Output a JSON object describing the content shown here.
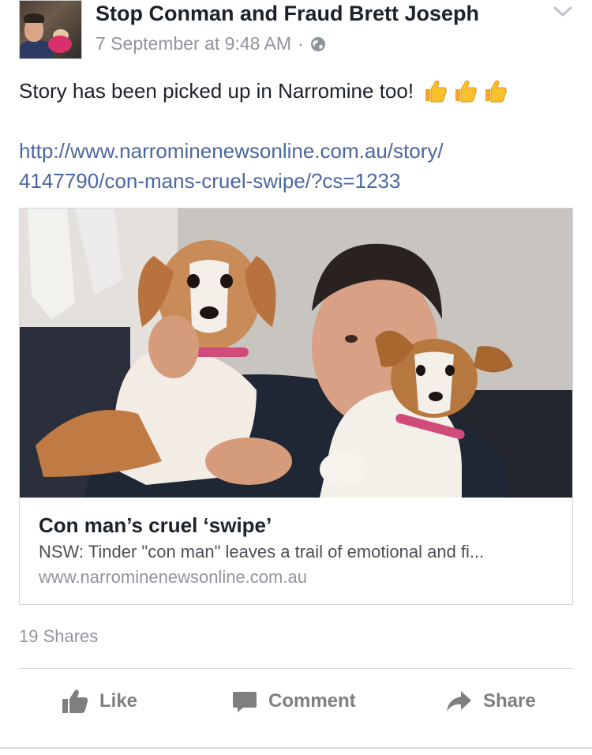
{
  "post": {
    "author": "Stop Conman and Fraud Brett Joseph",
    "timestamp": "7 September at 9:48 AM",
    "separator": "·",
    "audience_icon": "globe-icon",
    "menu_icon": "chevron-down-icon",
    "text": "Story has been picked up in Narromine too!",
    "emoji": [
      "thumbs-up-icon",
      "thumbs-up-icon",
      "thumbs-up-icon"
    ],
    "link_lines": [
      "http://www.narrominenewsonline.com.au/story/",
      "4147790/con-mans-cruel-swipe/?cs=1233"
    ]
  },
  "link_card": {
    "image_icon": "man-with-two-dogs-photo",
    "title": "Con man’s cruel ‘swipe’",
    "description": "NSW: Tinder \"con man\" leaves a trail of emotional and fi...",
    "domain": "www.narrominenewsonline.com.au"
  },
  "stats": {
    "shares": "19 Shares"
  },
  "actions": {
    "like": "Like",
    "comment": "Comment",
    "share": "Share"
  },
  "colors": {
    "link": "#4b67a1",
    "text": "#1d2129",
    "muted": "#90949c",
    "action": "#7f7f7f"
  }
}
